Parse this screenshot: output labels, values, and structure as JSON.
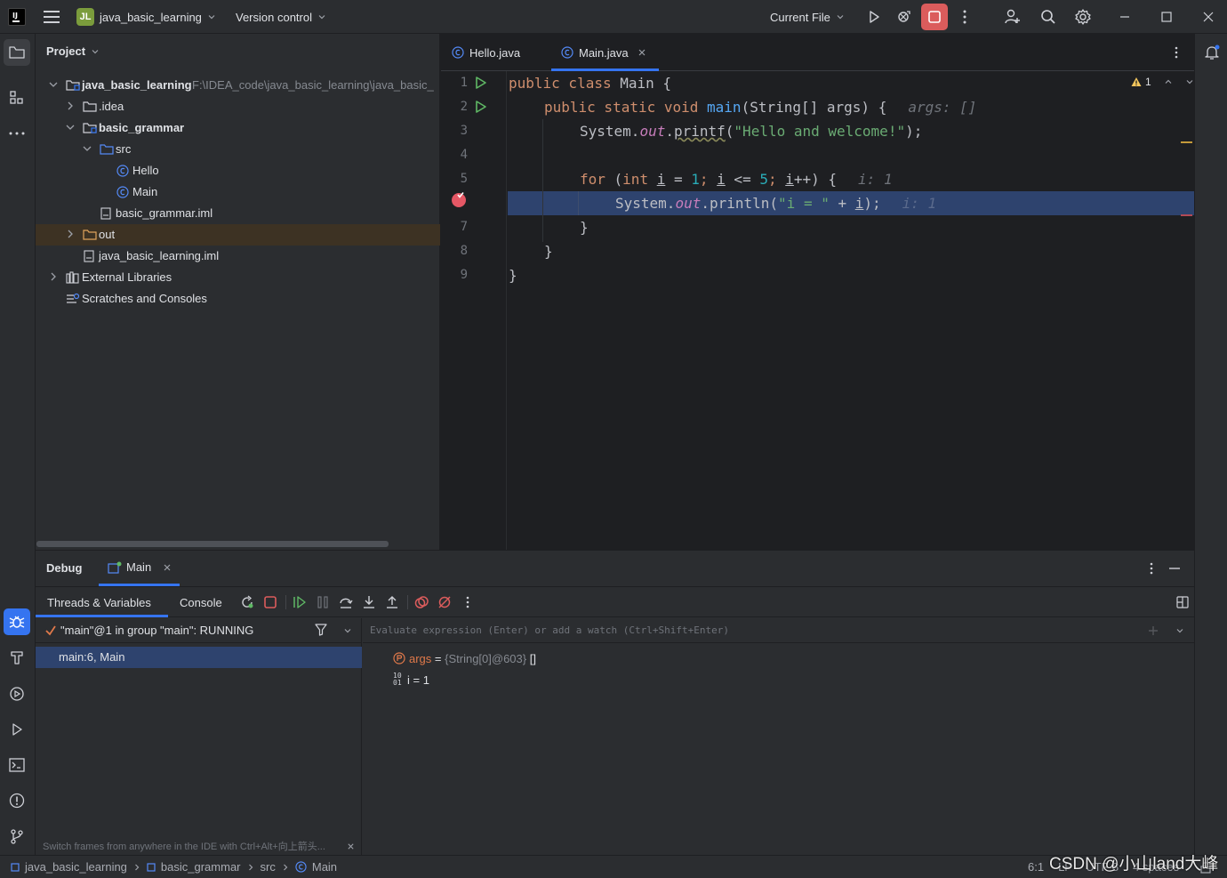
{
  "titlebar": {
    "project_badge": "JL",
    "project_name": "java_basic_learning",
    "vcs_label": "Version control",
    "run_config": "Current File"
  },
  "project_panel": {
    "title": "Project",
    "tree": [
      {
        "label": "java_basic_learning",
        "path": "F:\\IDEA_code\\java_basic_learning\\java_basic_"
      },
      {
        "label": ".idea"
      },
      {
        "label": "basic_grammar"
      },
      {
        "label": "src"
      },
      {
        "label": "Hello"
      },
      {
        "label": "Main"
      },
      {
        "label": "basic_grammar.iml"
      },
      {
        "label": "out"
      },
      {
        "label": "java_basic_learning.iml"
      },
      {
        "label": "External Libraries"
      },
      {
        "label": "Scratches and Consoles"
      }
    ]
  },
  "editor": {
    "tabs": [
      {
        "label": "Hello.java"
      },
      {
        "label": "Main.java"
      }
    ],
    "warnings_count": "1",
    "line_numbers": [
      "1",
      "2",
      "3",
      "4",
      "5",
      "",
      "7",
      "8",
      "9"
    ],
    "code": {
      "l1_a": "public class ",
      "l1_b": "Main {",
      "l2_a": "public static void ",
      "l2_b": "main",
      "l2_c": "(String[] args) {",
      "l2_hint": "args: []",
      "l3_a": "System.",
      "l3_b": "out",
      "l3_c": ".",
      "l3_d": "printf",
      "l3_e": "(",
      "l3_f": "\"Hello and welcome!\"",
      "l3_g": ");",
      "l5_a": "for ",
      "l5_b": "(",
      "l5_c": "int ",
      "l5_d": "i",
      "l5_e": " = ",
      "l5_f": "1",
      "l5_g": "; ",
      "l5_h": "i",
      "l5_i": " <= ",
      "l5_j": "5",
      "l5_k": "; ",
      "l5_l": "i",
      "l5_m": "++) {",
      "l5_hint": "i: 1",
      "l6_a": "System.",
      "l6_b": "out",
      "l6_c": ".println(",
      "l6_d": "\"i = \"",
      "l6_e": " + ",
      "l6_f": "i",
      "l6_g": ");",
      "l6_hint": "i: 1",
      "l7": "}",
      "l8": "}",
      "l9": "}"
    }
  },
  "debug_panel": {
    "title": "Debug",
    "session_tab": "Main",
    "subtabs": [
      {
        "label": "Threads & Variables"
      },
      {
        "label": "Console"
      }
    ],
    "thread": "\"main\"@1 in group \"main\": RUNNING",
    "frame": "main:6, Main",
    "evaluate_placeholder": "Evaluate expression (Enter) or add a watch (Ctrl+Shift+Enter)",
    "variables": [
      {
        "name": "args",
        "eq": " = ",
        "value": "{String[0]@603}",
        "extra": " []"
      },
      {
        "name": "i",
        "eq": " = ",
        "value": "1"
      }
    ],
    "hint": "Switch frames from anywhere in the IDE with Ctrl+Alt+向上箭头..."
  },
  "statusbar": {
    "breadcrumbs": [
      "java_basic_learning",
      "basic_grammar",
      "src",
      "Main"
    ],
    "position": "6:1",
    "line_sep": "LF",
    "encoding": "UTF-8",
    "indent": "4 spaces",
    "watermark": "CSDN @小山land大峰"
  },
  "colors": {
    "accent": "#3574f0",
    "selection": "#2e436e",
    "stop": "#db5c5c",
    "run": "#5fb865"
  }
}
